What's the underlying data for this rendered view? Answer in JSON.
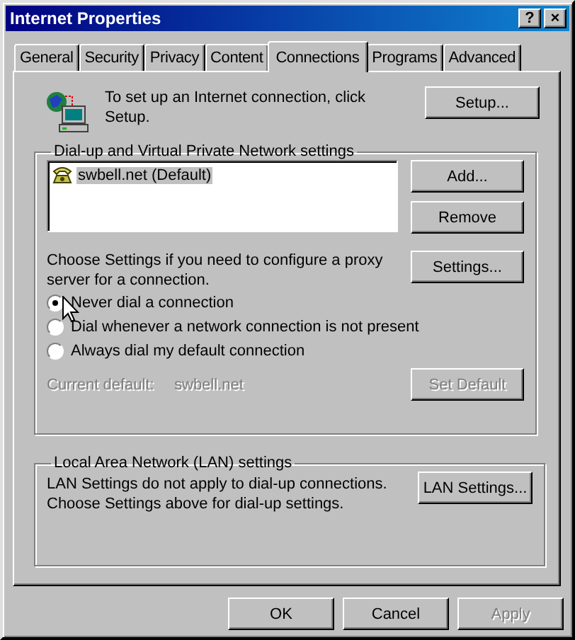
{
  "window": {
    "title": "Internet Properties",
    "title_buttons": [
      "?",
      "×"
    ]
  },
  "tabs": [
    {
      "label": "General",
      "selected": false
    },
    {
      "label": "Security",
      "selected": false
    },
    {
      "label": "Privacy",
      "selected": false
    },
    {
      "label": "Content",
      "selected": false
    },
    {
      "label": "Connections",
      "selected": true
    },
    {
      "label": "Programs",
      "selected": false
    },
    {
      "label": "Advanced",
      "selected": false
    }
  ],
  "setup": {
    "text": "To set up an Internet connection, click Setup.",
    "button": "Setup..."
  },
  "dialup": {
    "legend": "Dial-up and Virtual Private Network settings",
    "connections": [
      {
        "name": "swbell.net (Default)",
        "selected": true
      }
    ],
    "buttons": [
      {
        "label": "Add...",
        "disabled": false
      },
      {
        "label": "Remove",
        "disabled": false
      },
      {
        "label": "Settings...",
        "disabled": false
      }
    ],
    "proxy_note": "Choose Settings if you need to configure a proxy server for a connection.",
    "options": [
      {
        "label": "Never dial a connection",
        "selected": true
      },
      {
        "label": "Dial whenever a network connection is not present",
        "selected": false
      },
      {
        "label": "Always dial my default connection",
        "selected": false
      }
    ],
    "current_default": {
      "label": "Current default:",
      "value": "swbell.net",
      "disabled": true
    },
    "set_default": {
      "label": "Set Default",
      "disabled": true
    }
  },
  "lan": {
    "legend": "Local Area Network (LAN) settings",
    "lines": [
      "LAN Settings do not apply to dial-up connections.",
      "Choose Settings above for dial-up settings."
    ],
    "button": "LAN Settings..."
  },
  "buttons": [
    {
      "label": "OK",
      "disabled": false
    },
    {
      "label": "Cancel",
      "disabled": false
    },
    {
      "label": "Apply",
      "disabled": true
    }
  ]
}
